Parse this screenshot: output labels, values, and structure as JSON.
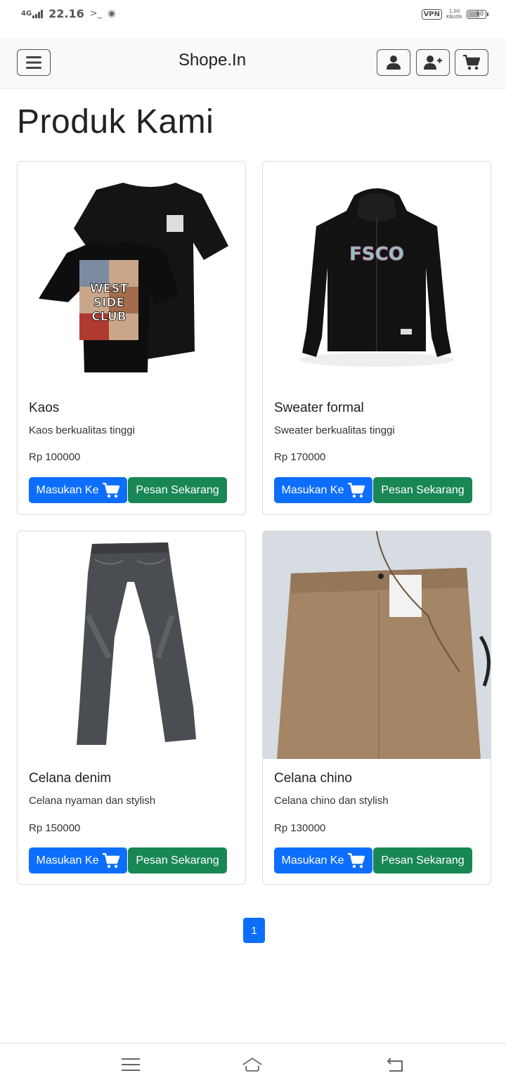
{
  "status_bar": {
    "network": "4G",
    "time": "22.16",
    "vpn": "VPN",
    "speed_value": "1,00",
    "speed_unit": "KB/dtk",
    "battery": "60"
  },
  "navbar": {
    "brand": "Shope.In",
    "icons": [
      "bars-icon",
      "user-icon",
      "user-plus-icon",
      "cart-icon"
    ]
  },
  "page": {
    "title": "Produk Kami"
  },
  "products": [
    {
      "name": "Kaos",
      "description": "Kaos berkualitas tinggi",
      "price": "Rp 100000",
      "cart_label": "Masukan Ke",
      "buy_label": "Pesan Sekarang"
    },
    {
      "name": "Sweater formal",
      "description": "Sweater berkualitas tinggi",
      "price": "Rp 170000",
      "cart_label": "Masukan Ke",
      "buy_label": "Pesan Sekarang"
    },
    {
      "name": "Celana denim",
      "description": "Celana nyaman dan stylish",
      "price": "Rp 150000",
      "cart_label": "Masukan Ke",
      "buy_label": "Pesan Sekarang"
    },
    {
      "name": "Celana chino",
      "description": "Celana chino dan stylish",
      "price": "Rp 130000",
      "cart_label": "Masukan Ke",
      "buy_label": "Pesan Sekarang"
    }
  ],
  "pagination": {
    "current": "1"
  },
  "colors": {
    "primary": "#0d6efd",
    "success": "#198754",
    "navbar_bg": "#f8f9fa"
  }
}
